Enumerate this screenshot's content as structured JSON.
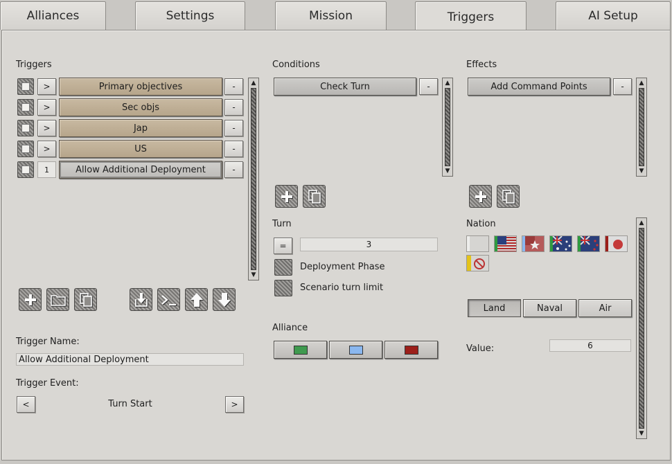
{
  "tabs": [
    "Alliances",
    "Settings",
    "Mission",
    "Triggers",
    "AI Setup"
  ],
  "triggers_panel": {
    "heading": "Triggers",
    "items": [
      {
        "expand": ">",
        "label": "Primary objectives",
        "remove": "-"
      },
      {
        "expand": ">",
        "label": "Sec objs",
        "remove": "-"
      },
      {
        "expand": ">",
        "label": "Jap",
        "remove": "-"
      },
      {
        "expand": ">",
        "label": "US",
        "remove": "-"
      },
      {
        "index": "1",
        "label": "Allow Additional Deployment",
        "remove": "-"
      }
    ]
  },
  "trigger_name": {
    "label": "Trigger Name:",
    "value": "Allow Additional Deployment"
  },
  "trigger_event": {
    "label": "Trigger Event:",
    "prev": "<",
    "value": "Turn Start",
    "next": ">"
  },
  "conditions": {
    "heading": "Conditions",
    "items": [
      {
        "label": "Check Turn",
        "remove": "-"
      }
    ]
  },
  "turn": {
    "heading": "Turn",
    "operator": "=",
    "value": "3",
    "options": [
      "Deployment Phase",
      "Scenario turn limit"
    ]
  },
  "alliance": {
    "heading": "Alliance",
    "colors": [
      "#3f9a4f",
      "#8ab7ef",
      "#9c1f1a"
    ]
  },
  "effects": {
    "heading": "Effects",
    "items": [
      {
        "label": "Add Command Points",
        "remove": "-"
      }
    ]
  },
  "nation": {
    "heading": "Nation",
    "flags": [
      "blank",
      "usa",
      "liberia",
      "australia-green",
      "new-zealand",
      "japan",
      "prohibited"
    ]
  },
  "unit_types": [
    "Land",
    "Naval",
    "Air"
  ],
  "value": {
    "label": "Value:",
    "value": "6"
  },
  "icons": {
    "add": "plus-icon",
    "copy": "copy-icon",
    "folder": "folder-icon",
    "import": "import-icon",
    "console": "console-icon",
    "up": "arrow-up-icon",
    "down": "arrow-down-icon"
  }
}
